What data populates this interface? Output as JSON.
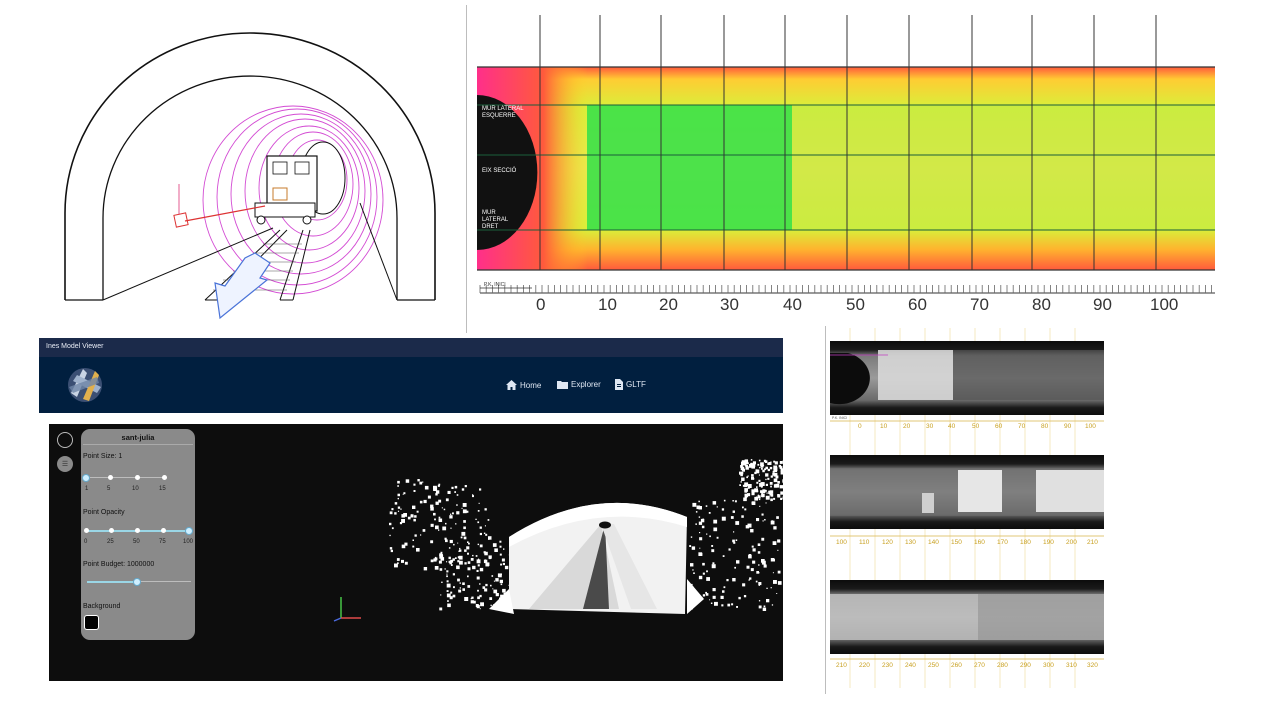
{
  "heatmap": {
    "side_labels": [
      "MUR LATERAL ESQUERRE",
      "EIX SECCIÓ",
      "MUR LATERAL DRET"
    ],
    "pk_label": "P.K. INICI",
    "axis_ticks": [
      "0",
      "10",
      "20",
      "30",
      "40",
      "50",
      "60",
      "70",
      "80",
      "90",
      "100"
    ]
  },
  "viewer": {
    "window_title": "Ines Model Viewer",
    "nav": {
      "home": "Home",
      "explorer": "Explorer",
      "gltf": "GLTF"
    },
    "panel": {
      "title": "sant-julia",
      "point_size_label": "Point Size: 1",
      "point_size_ticks": [
        "1",
        "5",
        "10",
        "15"
      ],
      "point_size_value": 1,
      "opacity_label": "Point Opacity",
      "opacity_ticks": [
        "0",
        "25",
        "50",
        "75",
        "100"
      ],
      "opacity_value": 100,
      "budget_label": "Point Budget: 1000000",
      "budget_fraction": 0.48,
      "background_label": "Background",
      "background_color": "#000000"
    }
  },
  "strips": {
    "pk_label": "P.K. INICI",
    "row1_ticks": [
      "0",
      "10",
      "20",
      "30",
      "40",
      "50",
      "60",
      "70",
      "80",
      "90",
      "100"
    ],
    "row2_ticks": [
      "100",
      "110",
      "120",
      "130",
      "140",
      "150",
      "160",
      "170",
      "180",
      "190",
      "200",
      "210"
    ],
    "row3_ticks": [
      "210",
      "220",
      "230",
      "240",
      "250",
      "260",
      "270",
      "280",
      "290",
      "300",
      "310",
      "320"
    ]
  },
  "colors": {
    "nav_bg": "#011f3f",
    "titlebar_bg": "#1b2a4a",
    "canvas_bg": "#0d0d0d",
    "panel_bg": "#8a8a8a",
    "accent": "#9ad6e6",
    "ruler_yellow": "#c8a020"
  }
}
